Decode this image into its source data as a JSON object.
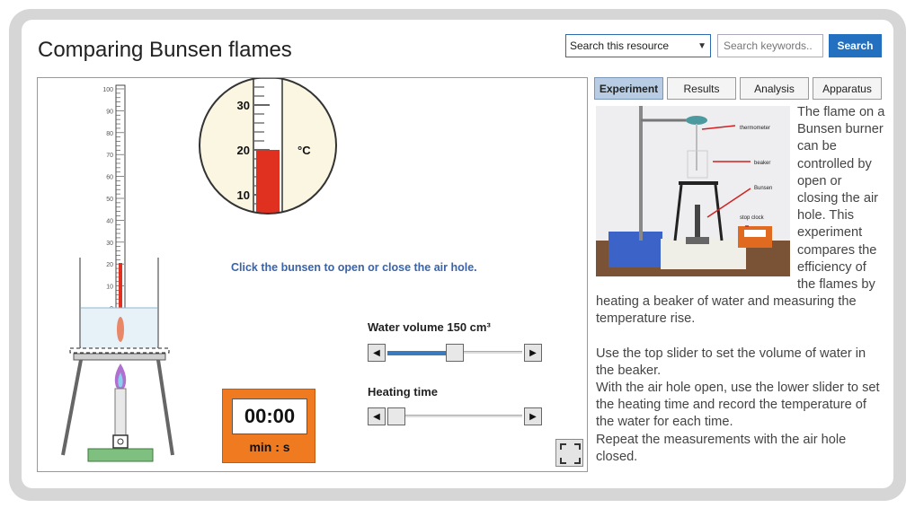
{
  "page": {
    "title": "Comparing Bunsen flames"
  },
  "search": {
    "scope_selected": "Search this resource",
    "placeholder": "Search keywords..",
    "button_label": "Search"
  },
  "tabs": [
    {
      "label": "Experiment",
      "active": true
    },
    {
      "label": "Results",
      "active": false
    },
    {
      "label": "Analysis",
      "active": false
    },
    {
      "label": "Apparatus",
      "active": false
    }
  ],
  "simulation": {
    "instruction": "Click the bunsen to open or close the air hole.",
    "thermometer_scale": [
      "100",
      "90",
      "80",
      "70",
      "60",
      "50",
      "40",
      "30",
      "20",
      "10",
      "0"
    ],
    "zoom_scale": [
      "30",
      "20",
      "10"
    ],
    "zoom_unit": "°C",
    "water_volume_label": "Water volume 150 cm³",
    "water_volume_fraction": 0.5,
    "heating_time_label": "Heating time",
    "heating_time_fraction": 0.0,
    "timer_display": "00:00",
    "timer_unit": "min : s",
    "flame_color": "#b070d0",
    "mercury_color": "#e03020"
  },
  "photo_labels": {
    "thermometer": "thermometer",
    "beaker": "beaker",
    "bunsen": "Bunsen",
    "stop_clock": "stop clock"
  },
  "description": {
    "intro": "The flame on a Bunsen burner can be controlled by open or closing the air hole. This experiment compares the efficiency of the flames by heating a beaker of water and measuring the temperature rise.",
    "instruction_1": "Use the top slider to set the volume of water in the beaker.",
    "instruction_2": "With the air hole open, use the lower slider to set the heating time and record the temperature of the water for each time.",
    "instruction_3": "Repeat the measurements with the air hole closed."
  },
  "colors": {
    "accent": "#2370c0",
    "tab_active": "#b8cde3",
    "timer": "#f07a20"
  }
}
